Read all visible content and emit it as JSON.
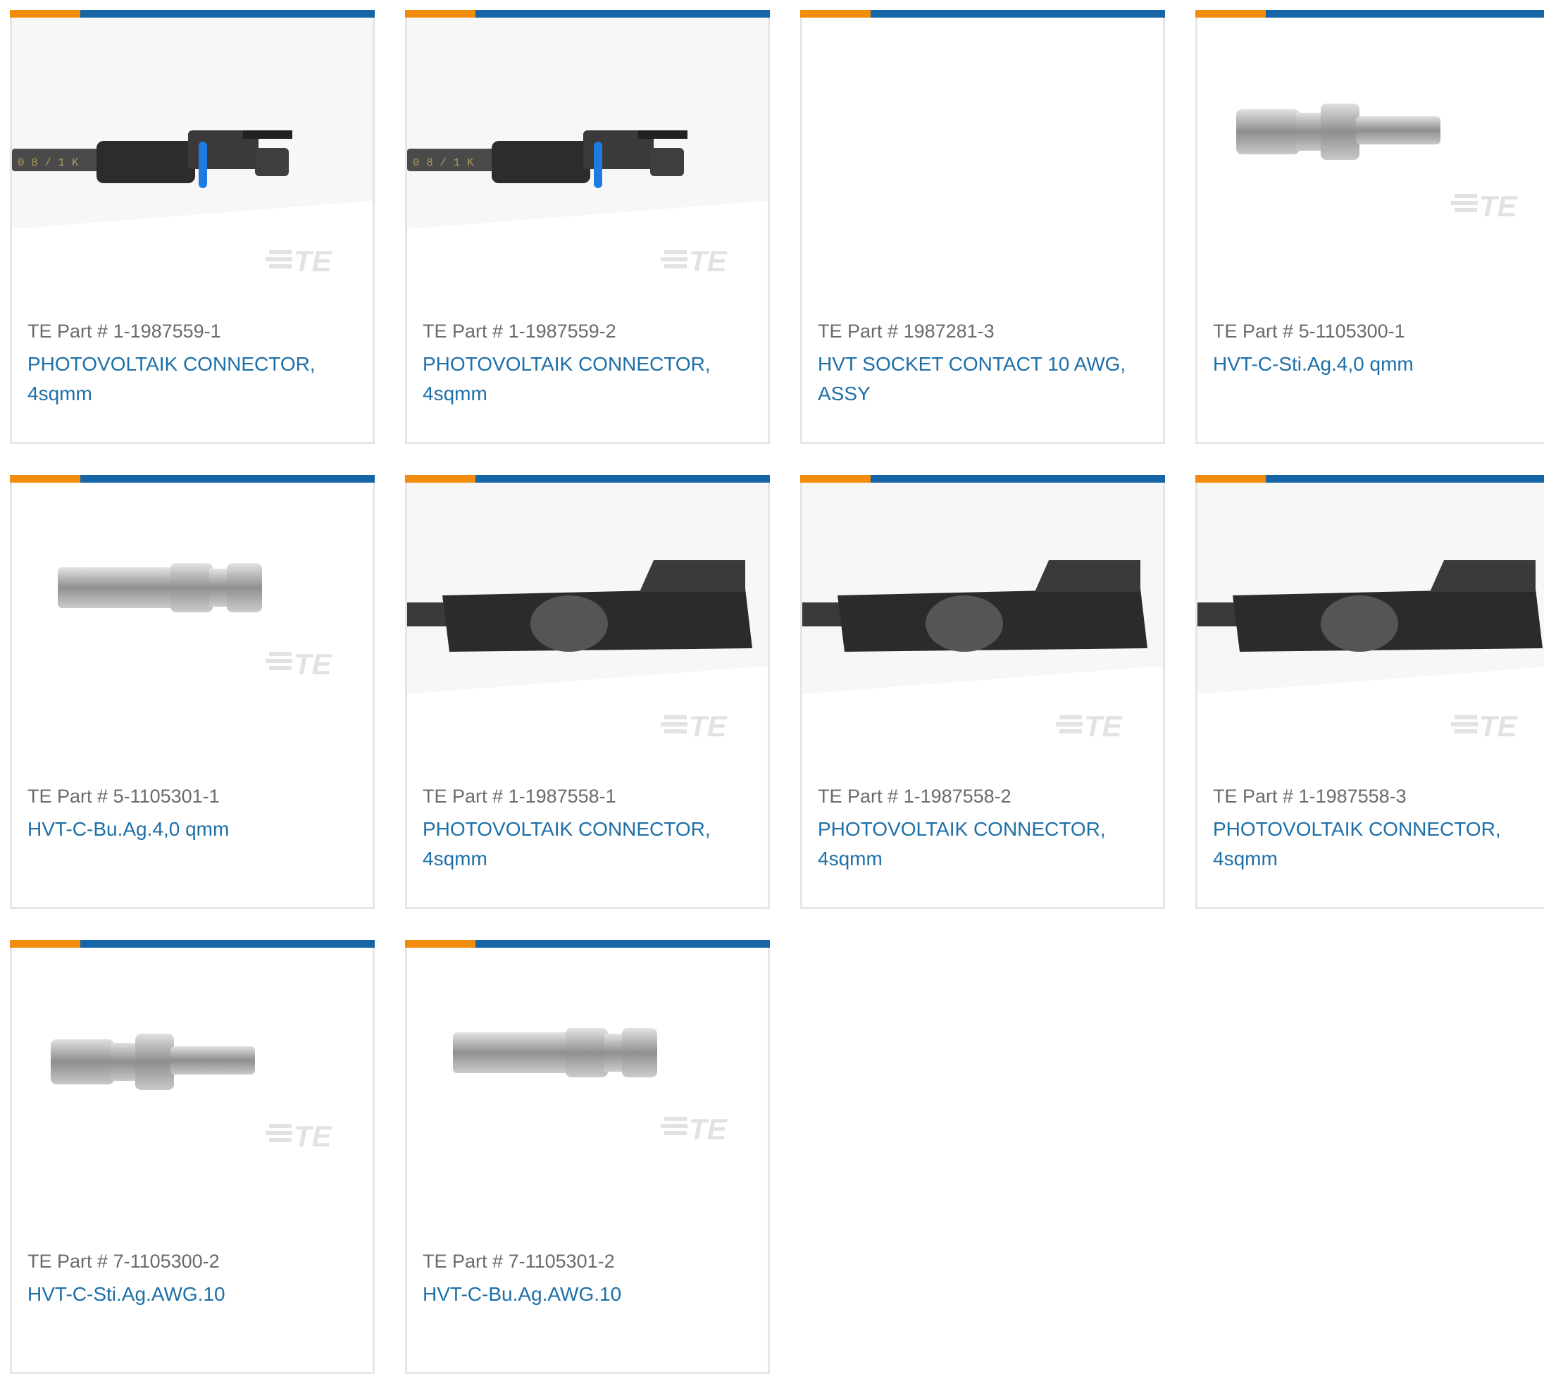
{
  "colors": {
    "accent_orange": "#f28c0d",
    "accent_blue": "#1565a7",
    "link_blue": "#1d6fa8",
    "label_gray": "#6b6b6b",
    "border_gray": "#e6e6e6"
  },
  "brand_watermark": "TE",
  "part_prefix": "TE Part #",
  "products": [
    {
      "part": "1-1987559-1",
      "description": "PHOTOVOLTAIK CONNECTOR, 4sqmm",
      "image": "connector-cable-icon"
    },
    {
      "part": "1-1987559-2",
      "description": "PHOTOVOLTAIK CONNECTOR, 4sqmm",
      "image": "connector-cable-icon"
    },
    {
      "part": "1987281-3",
      "description": "HVT SOCKET CONTACT 10 AWG, ASSY",
      "image": "none"
    },
    {
      "part": "5-1105300-1",
      "description": "HVT-C-Sti.Ag.4,0 qmm",
      "image": "pin-contact-icon"
    },
    {
      "part": "5-1105301-1",
      "description": "HVT-C-Bu.Ag.4,0 qmm",
      "image": "socket-contact-icon"
    },
    {
      "part": "1-1987558-1",
      "description": "PHOTOVOLTAIK CONNECTOR, 4sqmm",
      "image": "connector-housing-icon"
    },
    {
      "part": "1-1987558-2",
      "description": "PHOTOVOLTAIK CONNECTOR, 4sqmm",
      "image": "connector-housing-icon"
    },
    {
      "part": "1-1987558-3",
      "description": "PHOTOVOLTAIK CONNECTOR, 4sqmm",
      "image": "connector-housing-icon"
    },
    {
      "part": "7-1105300-2",
      "description": "HVT-C-Sti.Ag.AWG.10",
      "image": "pin-contact-icon"
    },
    {
      "part": "7-1105301-2",
      "description": "HVT-C-Bu.Ag.AWG.10",
      "image": "socket-contact-icon"
    }
  ]
}
